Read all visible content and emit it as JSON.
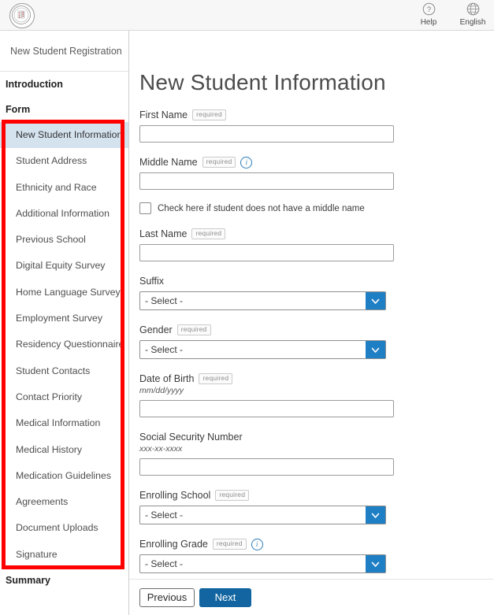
{
  "topbar": {
    "logo_name": "school-seal-logo",
    "actions": [
      {
        "label": "Help",
        "icon": "help-circle-icon",
        "glyph": "?"
      },
      {
        "label": "English",
        "icon": "globe-icon",
        "glyph": "⊕"
      }
    ]
  },
  "sidebar": {
    "header": "New Student Registration",
    "sections": {
      "introduction": "Introduction",
      "form": "Form",
      "summary": "Summary"
    },
    "items": [
      {
        "label": "New Student Information",
        "active": true
      },
      {
        "label": "Student Address",
        "active": false
      },
      {
        "label": "Ethnicity and Race",
        "active": false
      },
      {
        "label": "Additional Information",
        "active": false
      },
      {
        "label": "Previous School",
        "active": false
      },
      {
        "label": "Digital Equity Survey",
        "active": false
      },
      {
        "label": "Home Language Survey",
        "active": false
      },
      {
        "label": "Employment Survey",
        "active": false
      },
      {
        "label": "Residency Questionnaire",
        "active": false
      },
      {
        "label": "Student Contacts",
        "active": false
      },
      {
        "label": "Contact Priority",
        "active": false
      },
      {
        "label": "Medical Information",
        "active": false
      },
      {
        "label": "Medical History",
        "active": false
      },
      {
        "label": "Medication Guidelines",
        "active": false
      },
      {
        "label": "Agreements",
        "active": false
      },
      {
        "label": "Document Uploads",
        "active": false
      },
      {
        "label": "Signature",
        "active": false
      }
    ]
  },
  "annotation": {
    "color": "#fe0000",
    "name": "form-steps-highlight"
  },
  "main": {
    "title": "New Student Information",
    "required_badge": "required",
    "select_placeholder": "- Select -",
    "fields": {
      "first_name": {
        "label": "First Name",
        "value": "",
        "required": true
      },
      "middle_name": {
        "label": "Middle Name",
        "value": "",
        "required": true,
        "info": true
      },
      "no_middle_name": {
        "label": "Check here if student does not have a middle name",
        "checked": false
      },
      "last_name": {
        "label": "Last Name",
        "value": "",
        "required": true
      },
      "suffix": {
        "label": "Suffix",
        "value": "- Select -",
        "required": false
      },
      "gender": {
        "label": "Gender",
        "value": "- Select -",
        "required": true
      },
      "date_of_birth": {
        "label": "Date of Birth",
        "hint": "mm/dd/yyyy",
        "value": "",
        "required": true
      },
      "ssn": {
        "label": "Social Security Number",
        "hint": "xxx-xx-xxxx",
        "value": "",
        "required": false
      },
      "enrolling_school": {
        "label": "Enrolling School",
        "value": "- Select -",
        "required": true
      },
      "enrolling_grade": {
        "label": "Enrolling Grade",
        "value": "- Select -",
        "required": true,
        "info": true
      }
    }
  },
  "footer": {
    "previous": "Previous",
    "next": "Next"
  },
  "colors": {
    "accent_blue": "#1265a0",
    "dropdown_blue": "#1f7fc4",
    "active_nav": "#d5e3ef",
    "annotation_red": "#fe0000"
  }
}
